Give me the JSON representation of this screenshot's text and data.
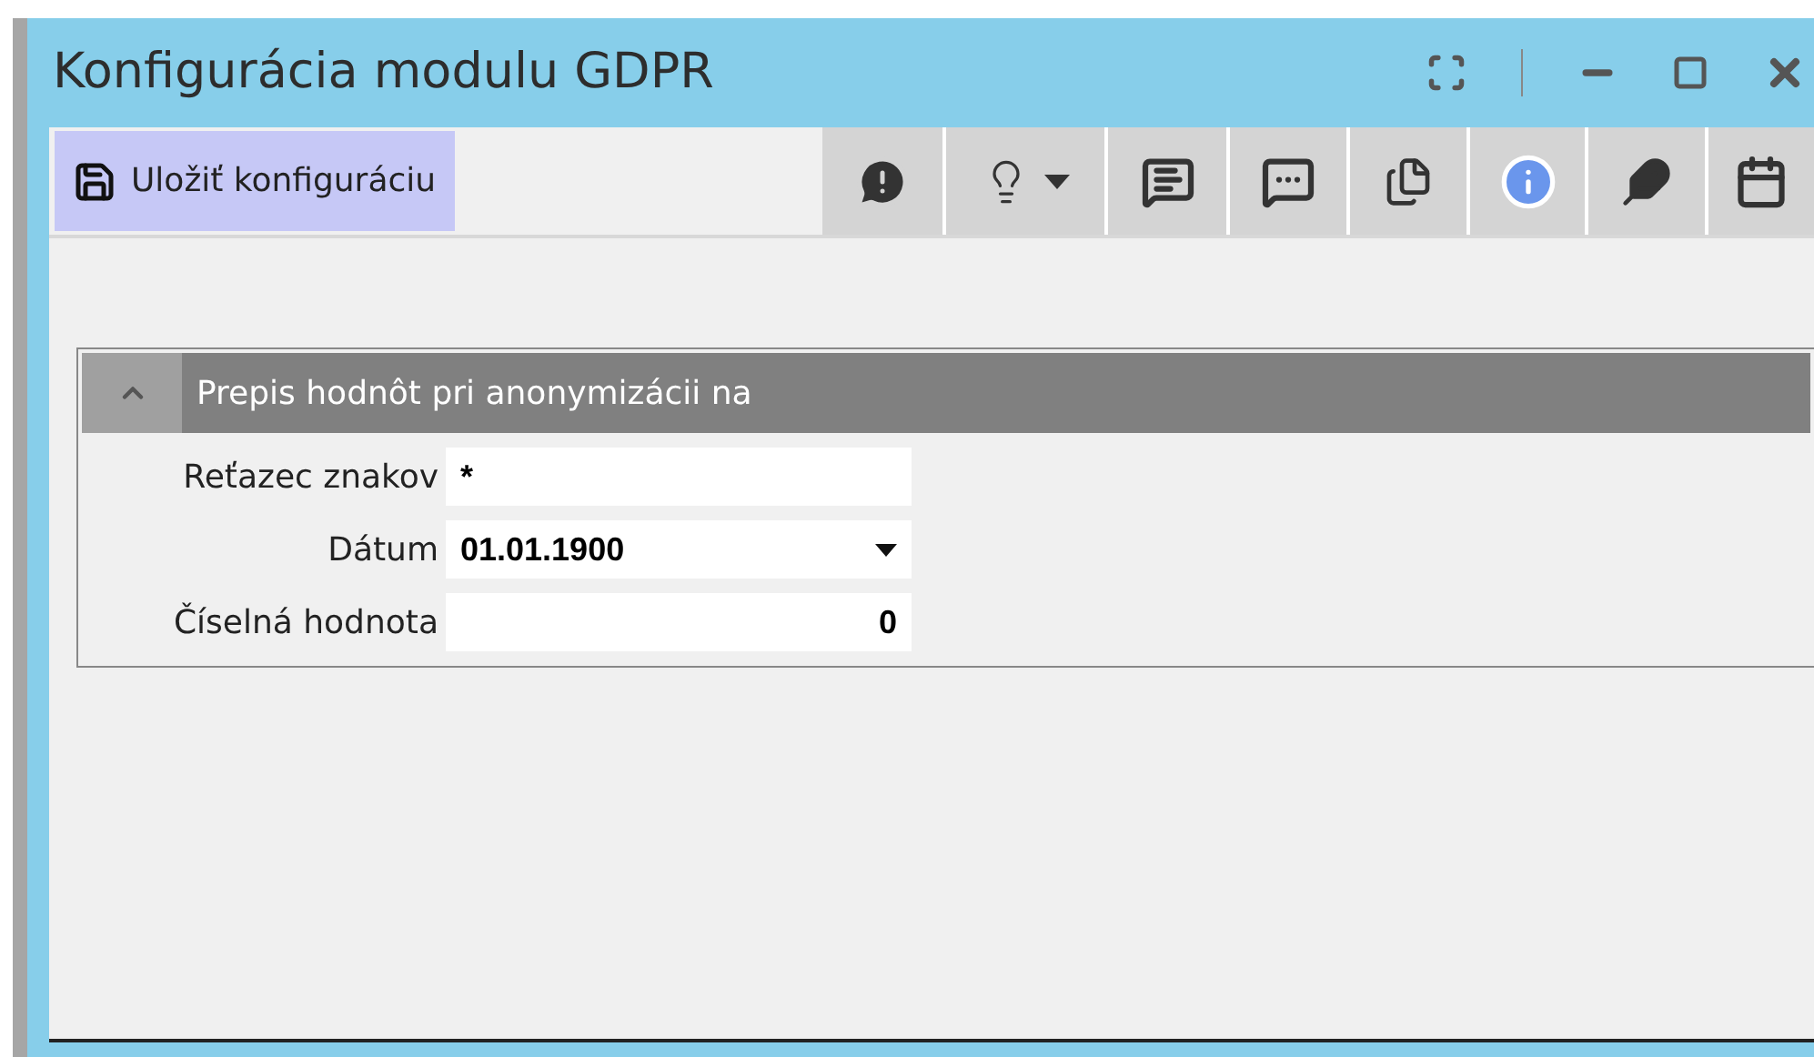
{
  "window": {
    "title": "Konfigurácia modulu GDPR"
  },
  "toolbar": {
    "save_button": {
      "label": "Uložiť konfiguráciu"
    }
  },
  "section": {
    "title": "Prepis hodnôt pri anonymizácii na",
    "expanded": true,
    "fields": [
      {
        "kind": "text",
        "label": "Reťazec znakov",
        "value": "*"
      },
      {
        "kind": "date",
        "label": "Dátum",
        "value": "01.01.1900"
      },
      {
        "kind": "number",
        "label": "Číselná hodnota",
        "value": "0"
      }
    ]
  }
}
